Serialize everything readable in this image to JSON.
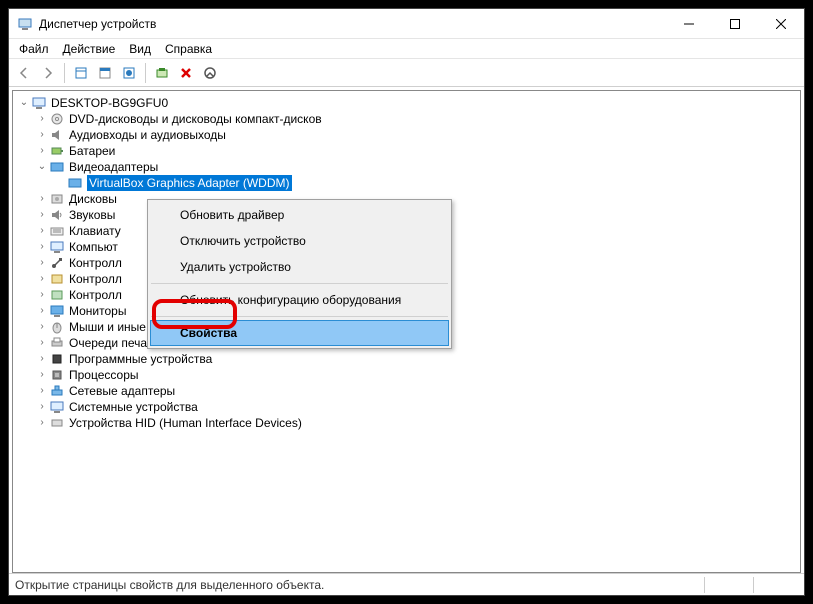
{
  "window": {
    "title": "Диспетчер устройств"
  },
  "menubar": {
    "file": "Файл",
    "action": "Действие",
    "view": "Вид",
    "help": "Справка"
  },
  "tree": {
    "root": "DESKTOP-BG9GFU0",
    "dvd": "DVD-дисководы и дисководы компакт-дисков",
    "audio": "Аудиовходы и аудиовыходы",
    "battery": "Батареи",
    "video": "Видеоадаптеры",
    "video_child": "VirtualBox Graphics Adapter (WDDM)",
    "disks": "Дисковы",
    "sound": "Звуковы",
    "keyboard": "Клавиату",
    "computer": "Компьют",
    "ctrl1": "Контролл",
    "ctrl2": "Контролл",
    "ctrl3": "Контролл",
    "monitors": "Мониторы",
    "mice": "Мыши и иные указывающие устройства",
    "printq": "Очереди печати",
    "soft": "Программные устройства",
    "cpu": "Процессоры",
    "net": "Сетевые адаптеры",
    "sys": "Системные устройства",
    "hid": "Устройства HID (Human Interface Devices)"
  },
  "context_menu": {
    "update": "Обновить драйвер",
    "disable": "Отключить устройство",
    "uninstall": "Удалить устройство",
    "scan": "Обновить конфигурацию оборудования",
    "properties": "Свойства"
  },
  "statusbar": {
    "text": "Открытие страницы свойств для выделенного объекта."
  }
}
